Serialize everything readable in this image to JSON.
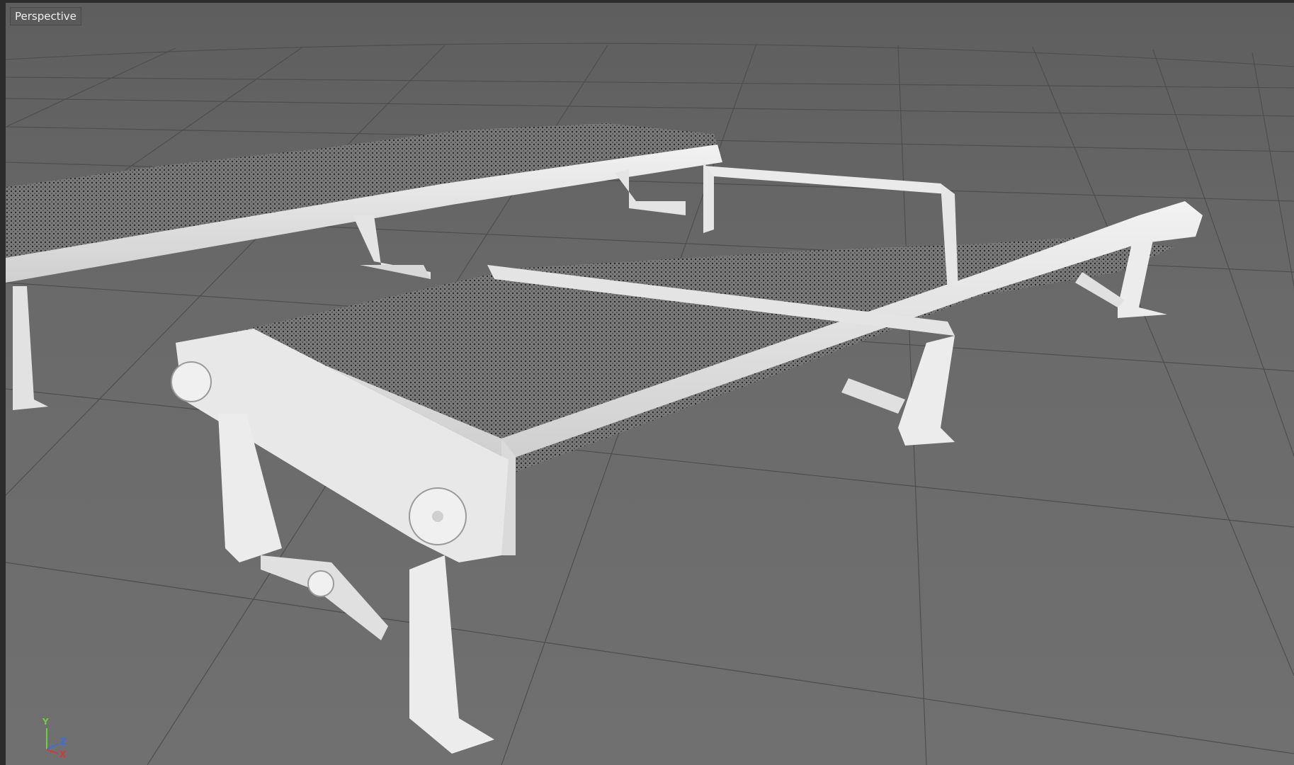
{
  "viewport": {
    "label": "Perspective"
  },
  "axis_gizmo": {
    "y_label": "Y",
    "z_label": "Z",
    "x_label": "X",
    "colors": {
      "x": "#d23a3a",
      "y": "#6fcf3d",
      "z": "#3a6fdc"
    }
  },
  "icons": {
    "axis": "axis-gizmo-icon"
  },
  "colors": {
    "background": "#676767",
    "grid": "#4e4e4e",
    "model": "#e6e6e6",
    "mesh": "#6d6d6d"
  }
}
